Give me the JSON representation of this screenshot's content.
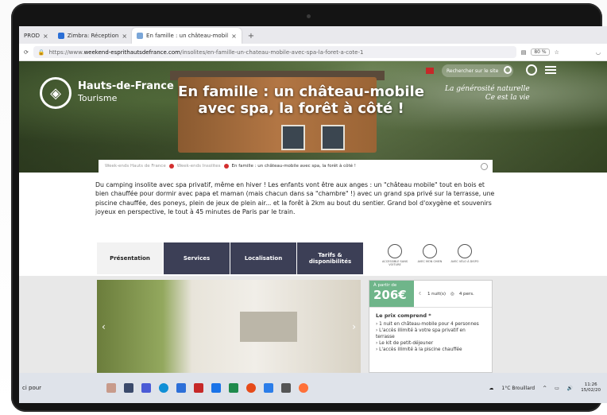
{
  "browser": {
    "tabs": [
      {
        "label": "PROD"
      },
      {
        "label": "Zimbra: Réception"
      },
      {
        "label": "En famille : un château-mobil"
      }
    ],
    "new_tab": "+",
    "url_prefix": "https://www.",
    "url_domain": "weekend-esprithautsdefrance.com",
    "url_path": "/insolites/en-famille-un-chateau-mobile-avec-spa-la-foret-a-cote-1",
    "zoom": "80 %"
  },
  "site": {
    "logo_title": "Hauts-de-France",
    "logo_sub": "Tourisme",
    "search_placeholder": "Rechercher sur le site",
    "tagline_line1": "La générosité naturelle",
    "tagline_line2": "Ce est la vie",
    "hero_title": "En famille : un château-mobile avec spa, la forêt à côté !"
  },
  "breadcrumb": [
    "Week-ends Hauts de France",
    "Week-ends Insolites",
    "En famille : un château-mobile avec spa, la forêt à côté !"
  ],
  "intro": "Du camping insolite avec spa privatif, même en hiver ! Les enfants vont être aux anges : un \"château mobile\" tout en bois et bien chauffée pour dormir avec papa et maman (mais chacun dans sa \"chambre\" !) avec un grand spa privé sur la terrasse, une piscine chauffée, des poneys, plein de jeux de plein air... et la forêt à 2km au bout du sentier. Grand bol d'oxygène et souvenirs joyeux en perspective, le tout à 45 minutes de Paris par le train.",
  "page_tabs": [
    "Présentation",
    "Services",
    "Localisation",
    "Tarifs & disponibilités"
  ],
  "features": [
    {
      "label": "ACCESSIBLE SANS VOITURE"
    },
    {
      "label": "AVEC MON CHIEN"
    },
    {
      "label": "AVEC VÉLO À DISPO"
    }
  ],
  "price": {
    "from": "À partir de",
    "amount": "206€",
    "nights": "1 nuit(s)",
    "persons": "4 pers.",
    "includes_title": "Le prix comprend *",
    "includes": [
      "1 nuit en château-mobile pour 4 personnes",
      "L'accès illimité à votre spa privatif en terrasse",
      "Le kit de petit-déjeuner",
      "L'accès illimité à la piscine chauffée"
    ]
  },
  "taskbar": {
    "left_text": "ci pour",
    "weather": "1°C Brouillard",
    "time": "11:26",
    "date": "15/02/20"
  },
  "colors": {
    "tab_dark": "#3c3f56",
    "price_green": "#6fb58a",
    "accent_red": "#d32f2f"
  }
}
